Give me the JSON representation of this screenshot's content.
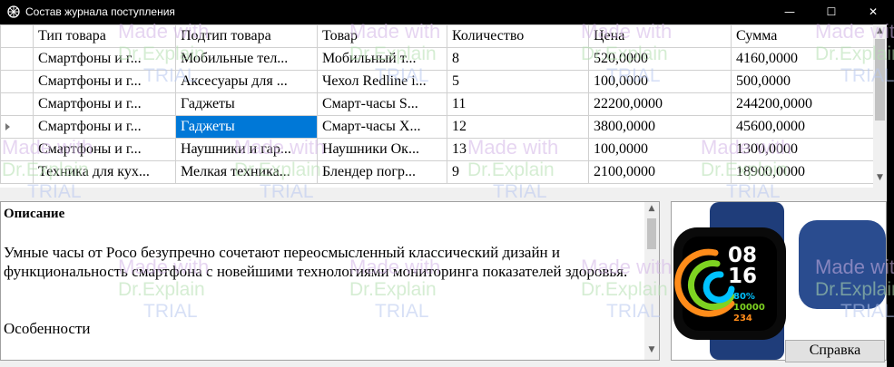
{
  "window": {
    "title": "Состав журнала поступления",
    "minimize_glyph": "—",
    "maximize_glyph": "☐",
    "close_glyph": "✕"
  },
  "grid": {
    "columns": [
      "Тип товара",
      "Подтип товара",
      "Товар",
      "Количество",
      "Цена",
      "Сумма"
    ],
    "rows": [
      [
        "Смартфоны и г...",
        "Мобильные тел...",
        "Мобильный т...",
        "8",
        "520,0000",
        "4160,0000"
      ],
      [
        "Смартфоны и г...",
        "Аксесуары для ...",
        "Чехол Redline i...",
        "5",
        "100,0000",
        "500,0000"
      ],
      [
        "Смартфоны и г...",
        "Гаджеты",
        "Смарт-часы S...",
        "11",
        "22200,0000",
        "244200,0000"
      ],
      [
        "Смартфоны и г...",
        "Гаджеты",
        "Смарт-часы X...",
        "12",
        "3800,0000",
        "45600,0000"
      ],
      [
        "Смартфоны и г...",
        "Наушники и гар...",
        "Наушники Ок...",
        "13",
        "100,0000",
        "1300,0000"
      ],
      [
        "Техника для кух...",
        "Мелкая техника...",
        "Блендер погр...",
        "9",
        "2100,0000",
        "18900,0000"
      ]
    ],
    "selected_row": 3,
    "selected_col": 1,
    "selection_color": "#0078d7"
  },
  "description": {
    "heading": "Описание",
    "body": "Умные часы от Poco безупречно сочетают переосмысленный классический дизайн и функциональность смартфона с новейшими технологиями мониторинга показателей здоровья.",
    "features_label": "Особенности"
  },
  "product_image": {
    "time_hours": "08",
    "time_minutes": "16",
    "stat_percent": "80%",
    "stat_steps": "10000",
    "stat_calories": "234",
    "strap_color": "#1f3d7a",
    "ring_colors": [
      "#ff8c1a",
      "#7ed321",
      "#00c2ff"
    ]
  },
  "buttons": {
    "help_label": "Справка"
  },
  "watermark": {
    "line1": "Made with",
    "line2": "Dr.Explain",
    "line3": "TRIAL"
  },
  "icons": [
    "app-icon",
    "minimize-icon",
    "maximize-icon",
    "close-icon",
    "row-indicator-icon",
    "scroll-up-icon",
    "scroll-down-icon"
  ]
}
